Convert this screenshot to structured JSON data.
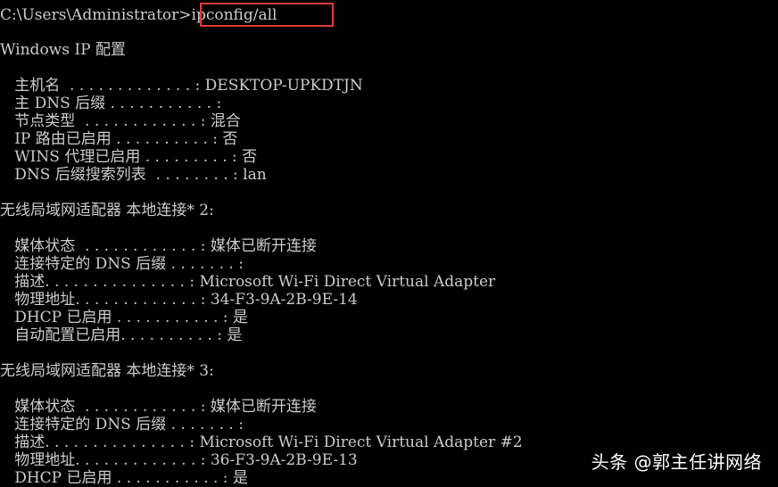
{
  "terminal": {
    "prompt": "C:\\Users\\Administrator>",
    "command": "ipconfig/all",
    "highlight_color": "#e03c3c",
    "lines": [
      "Windows IP 配置",
      "",
      "   主机名  . . . . . . . . . . . . . : DESKTOP-UPKDTJN",
      "   主 DNS 后缀 . . . . . . . . . . . :",
      "   节点类型  . . . . . . . . . . . . : 混合",
      "   IP 路由已启用 . . . . . . . . . . : 否",
      "   WINS 代理已启用 . . . . . . . . . : 否",
      "   DNS 后缀搜索列表  . . . . . . . . : lan",
      "",
      "无线局域网适配器 本地连接* 2:",
      "",
      "   媒体状态  . . . . . . . . . . . . : 媒体已断开连接",
      "   连接特定的 DNS 后缀 . . . . . . . :",
      "   描述. . . . . . . . . . . . . . . : Microsoft Wi-Fi Direct Virtual Adapter",
      "   物理地址. . . . . . . . . . . . . : 34-F3-9A-2B-9E-14",
      "   DHCP 已启用 . . . . . . . . . . . : 是",
      "   自动配置已启用. . . . . . . . . . : 是",
      "",
      "无线局域网适配器 本地连接* 3:",
      "",
      "   媒体状态  . . . . . . . . . . . . : 媒体已断开连接",
      "   连接特定的 DNS 后缀 . . . . . . . :",
      "   描述. . . . . . . . . . . . . . . : Microsoft Wi-Fi Direct Virtual Adapter #2",
      "   物理地址. . . . . . . . . . . . . : 36-F3-9A-2B-9E-13",
      "   DHCP 已启用 . . . . . . . . . . . : 是"
    ]
  },
  "watermark": {
    "text": "头条 @郭主任讲网络"
  }
}
